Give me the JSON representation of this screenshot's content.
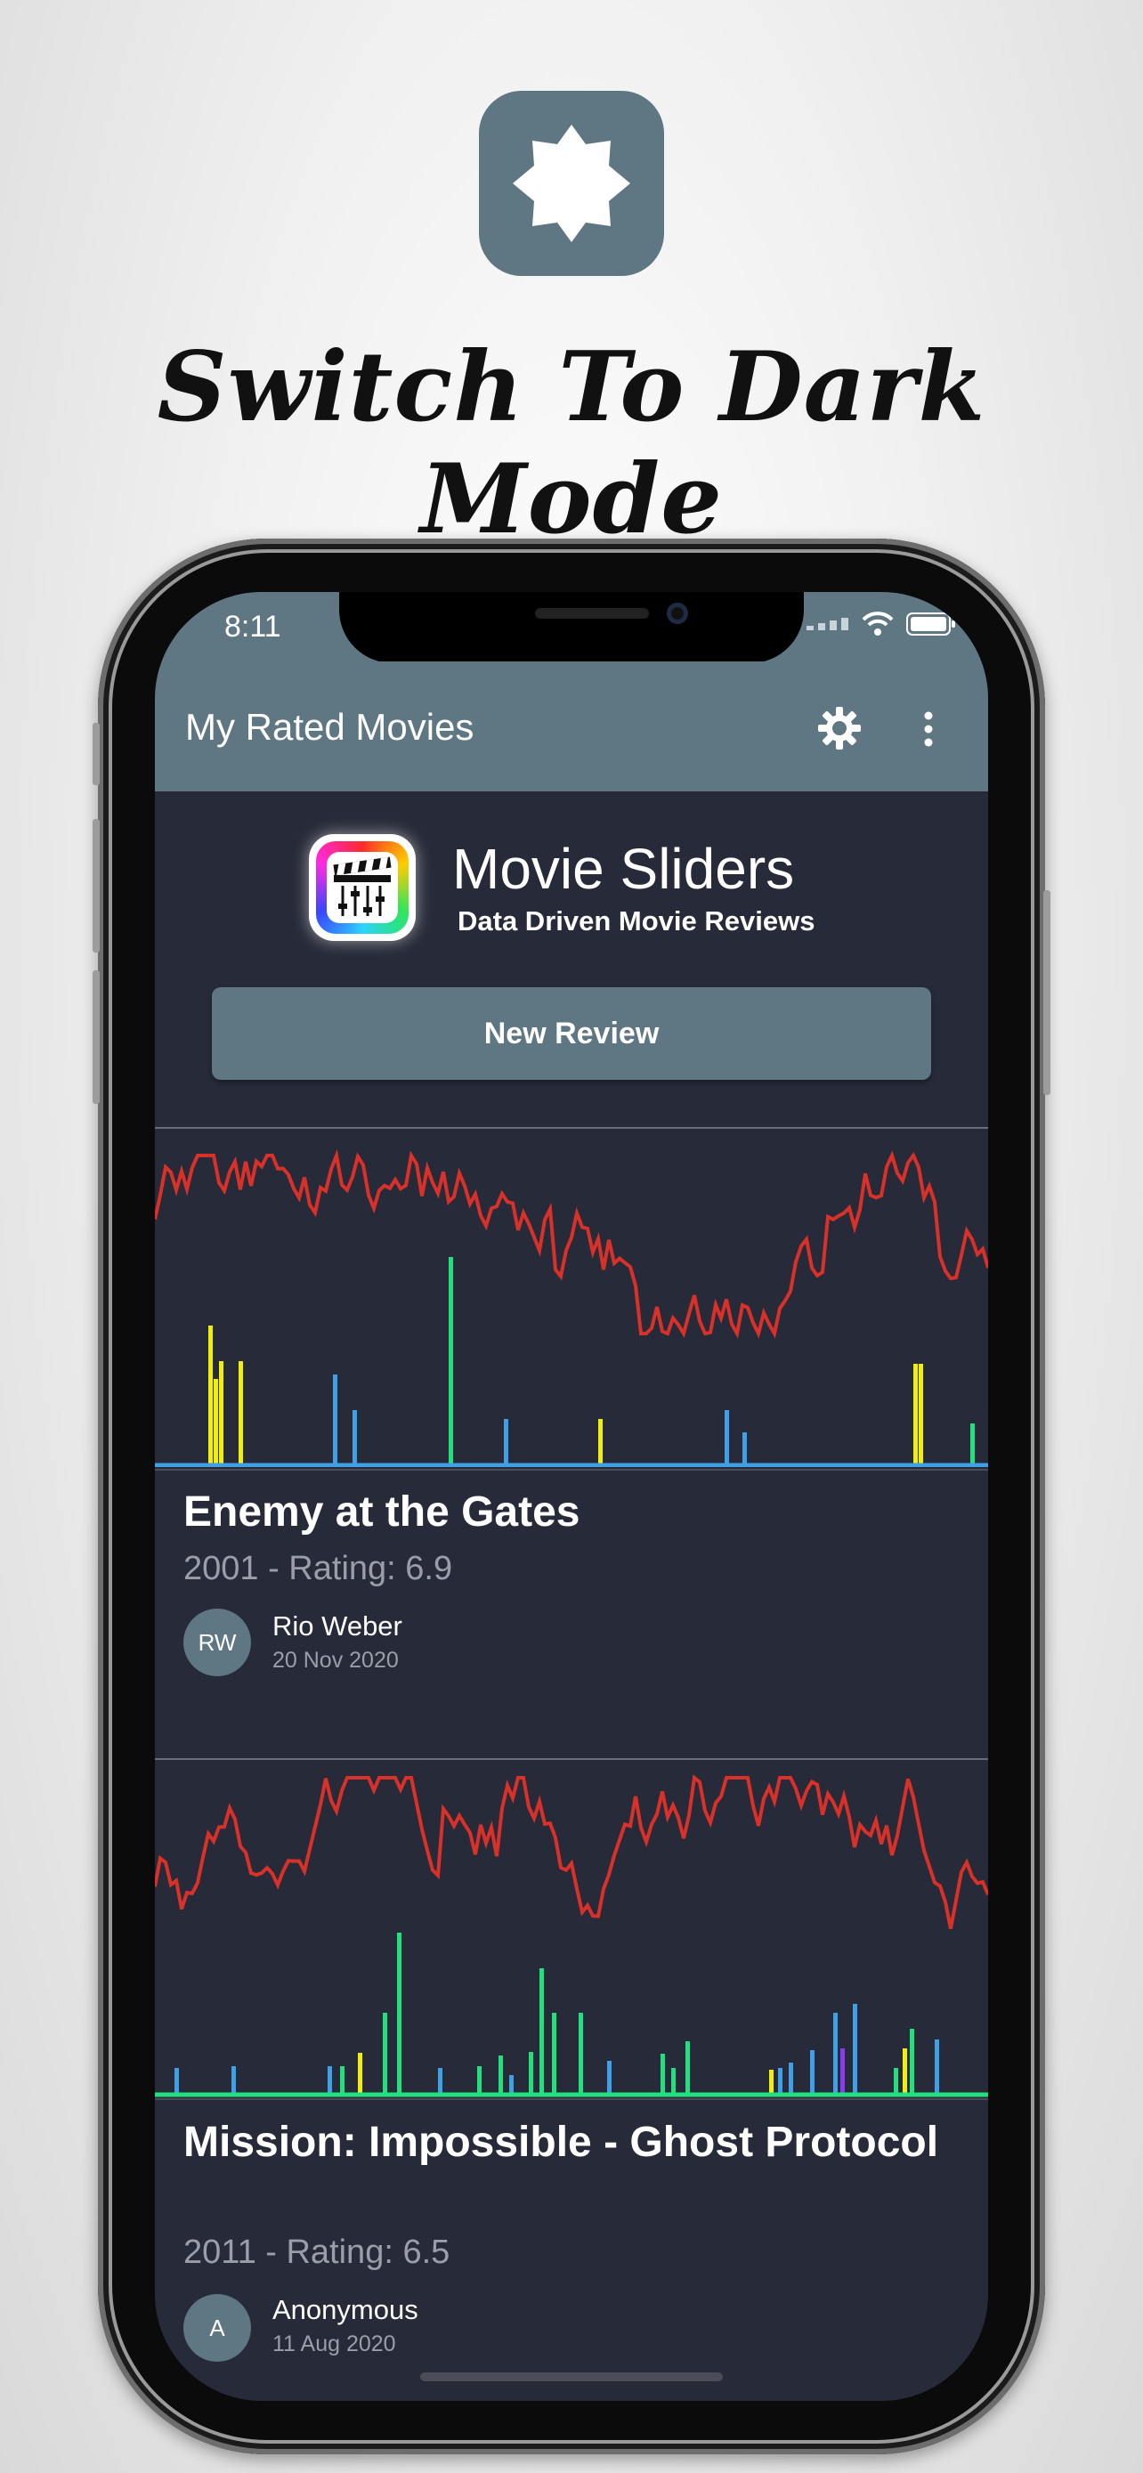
{
  "promo": {
    "icon": "brightness-icon",
    "headline": "Switch To Dark Mode"
  },
  "status_bar": {
    "time": "8:11",
    "icons": [
      "signal-icon",
      "wifi-icon",
      "battery-icon"
    ]
  },
  "app_bar": {
    "title": "My Rated Movies",
    "icons": [
      "settings-gear-icon",
      "more-vert-icon"
    ]
  },
  "header": {
    "app_name": "Movie Sliders",
    "tagline": "Data Driven Movie Reviews",
    "new_review_label": "New Review"
  },
  "reviews": [
    {
      "title": "Enemy at the Gates",
      "subtitle": "2001 - Rating: 6.9",
      "author": "Rio Weber",
      "initials": "RW",
      "date": "20 Nov 2020"
    },
    {
      "title": "Mission: Impossible - Ghost Protocol",
      "subtitle": "2011 - Rating: 6.5",
      "author": "Anonymous",
      "initials": "A",
      "date": "11 Aug 2020"
    }
  ],
  "colors": {
    "accent": "#5f7683",
    "background": "#272a38",
    "series_red": "#d7312a",
    "series_yellow": "#f2ee0c",
    "series_blue": "#3fa0e6",
    "series_green": "#22e07e",
    "series_purple": "#8b3cf0"
  }
}
